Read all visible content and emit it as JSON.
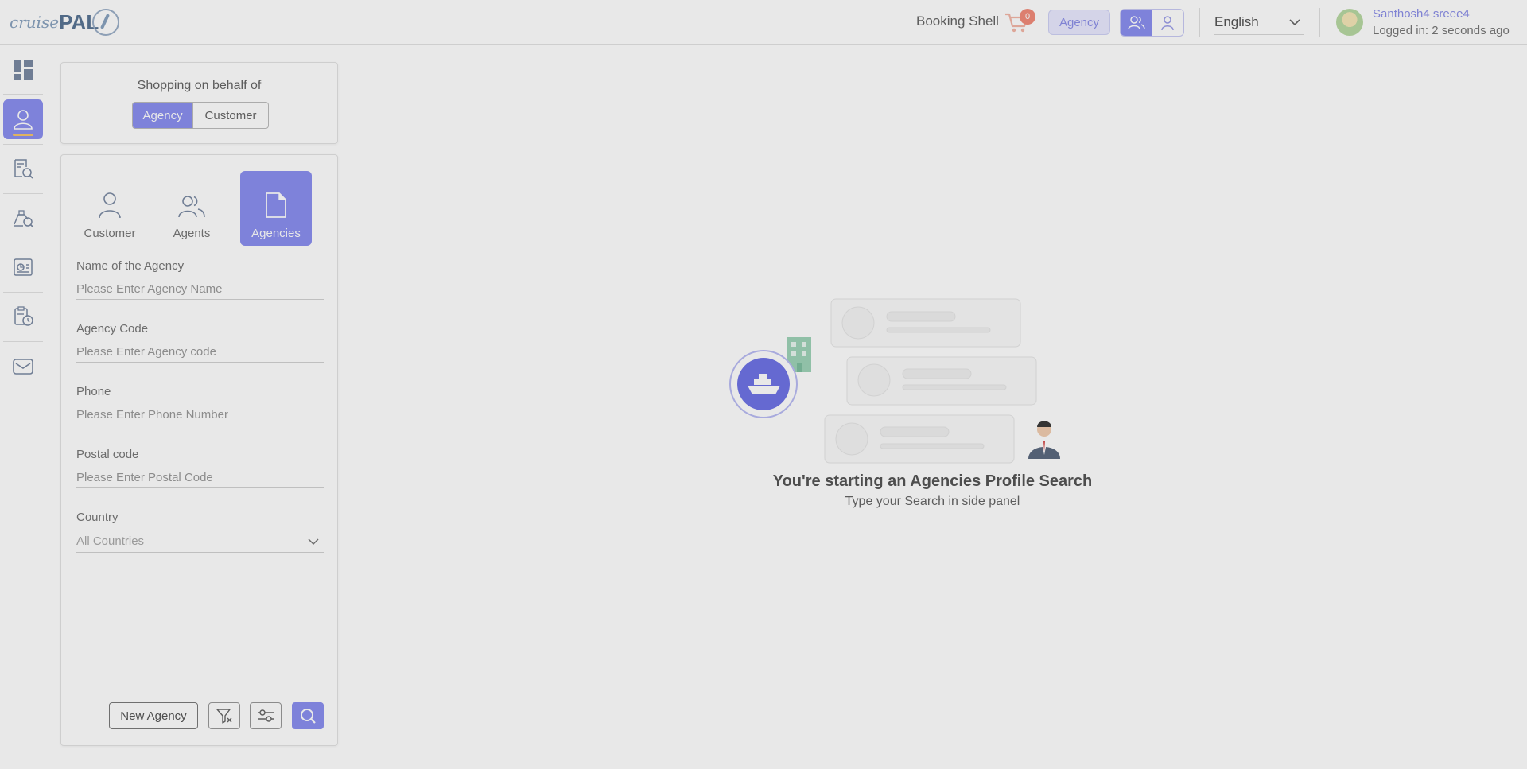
{
  "header": {
    "logo_text_cruise": "cruise",
    "logo_text_pal": "PAL",
    "booking_shell_label": "Booking Shell",
    "cart_count": "0",
    "agency_badge": "Agency",
    "language": "English",
    "user_name": "Santhosh4 sreee4",
    "user_status": "Logged in: 2 seconds ago",
    "colors": {
      "accent": "#8b8ff0",
      "badge": "#f28c7a"
    }
  },
  "rail": {
    "items": [
      {
        "icon": "dashboard-icon"
      },
      {
        "icon": "profile-search-icon",
        "active": true
      },
      {
        "icon": "booking-search-icon"
      },
      {
        "icon": "cruise-search-icon"
      },
      {
        "icon": "reports-icon"
      },
      {
        "icon": "history-icon"
      },
      {
        "icon": "mail-icon"
      }
    ]
  },
  "behalf": {
    "title": "Shopping on behalf of",
    "options": [
      "Agency",
      "Customer"
    ],
    "selected": "Agency"
  },
  "search_panel": {
    "types": [
      {
        "label": "Customer",
        "icon": "person-icon"
      },
      {
        "label": "Agents",
        "icon": "people-icon"
      },
      {
        "label": "Agencies",
        "icon": "document-icon",
        "active": true
      }
    ],
    "fields": {
      "agency_name": {
        "label": "Name of the Agency",
        "placeholder": "Please Enter Agency Name",
        "value": ""
      },
      "agency_code": {
        "label": "Agency Code",
        "placeholder": "Please Enter Agency code",
        "value": ""
      },
      "phone": {
        "label": "Phone",
        "placeholder": "Please Enter Phone Number",
        "value": ""
      },
      "postal": {
        "label": "Postal code",
        "placeholder": "Please Enter Postal Code",
        "value": ""
      },
      "country": {
        "label": "Country",
        "selected": "All Countries"
      }
    },
    "buttons": {
      "new_agency": "New Agency",
      "clear_filter_icon": "filter-clear-icon",
      "settings_icon": "sliders-icon",
      "search_icon": "search-icon"
    }
  },
  "empty_state": {
    "title": "You're starting an Agencies Profile Search",
    "subtitle": "Type your Search in side panel"
  }
}
